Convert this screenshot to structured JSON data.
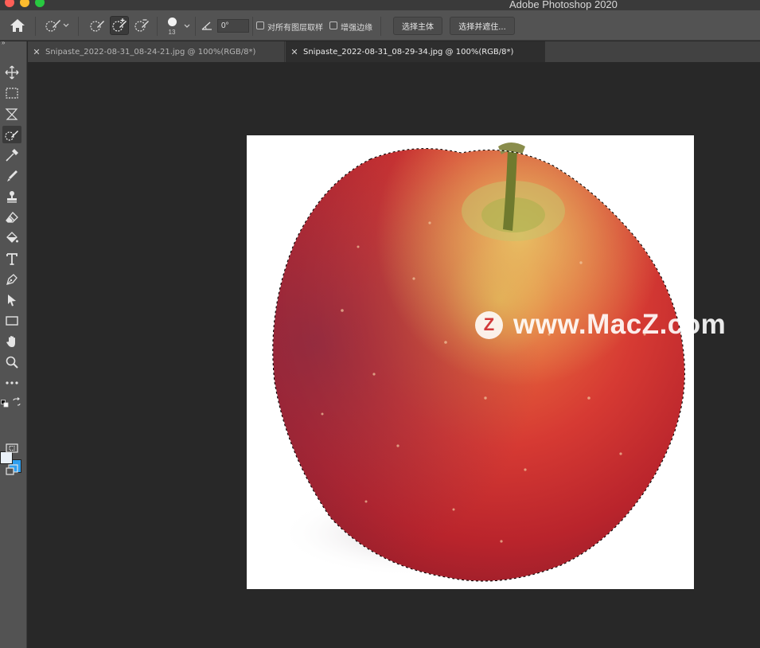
{
  "window": {
    "title": "Adobe Photoshop 2020"
  },
  "options_bar": {
    "brush_size": "13",
    "angle_value": "0°",
    "sample_all_layers_label": "对所有图层取样",
    "sample_all_layers_checked": false,
    "enhance_edge_label": "增强边缘",
    "enhance_edge_checked": false,
    "select_subject_label": "选择主体",
    "select_and_mask_label": "选择并遮住..."
  },
  "tabs": [
    {
      "label": "Snipaste_2022-08-31_08-24-21.jpg @ 100%(RGB/8*)",
      "active": false
    },
    {
      "label": "Snipaste_2022-08-31_08-29-34.jpg @ 100%(RGB/8*)",
      "active": true
    }
  ],
  "toolbar": {
    "collapse": "»",
    "tools": [
      "move-tool-icon",
      "marquee-tool-icon",
      "lasso-tool-icon",
      "quick-selection-tool-icon",
      "eyedropper-tool-icon",
      "brush-tool-icon",
      "stamp-tool-icon",
      "eraser-tool-icon",
      "paint-bucket-tool-icon",
      "type-tool-icon",
      "pen-tool-icon",
      "path-selection-tool-icon",
      "rectangle-tool-icon",
      "hand-tool-icon",
      "zoom-tool-icon",
      "more-tools-icon"
    ],
    "active_tool": "quick-selection-tool-icon",
    "foreground_color": "#eaf1f8",
    "background_color": "#2f9ff0"
  },
  "canvas": {
    "image_subject": "apple-image",
    "watermark_text": "www.MacZ.com",
    "watermark_badge": "Z"
  }
}
